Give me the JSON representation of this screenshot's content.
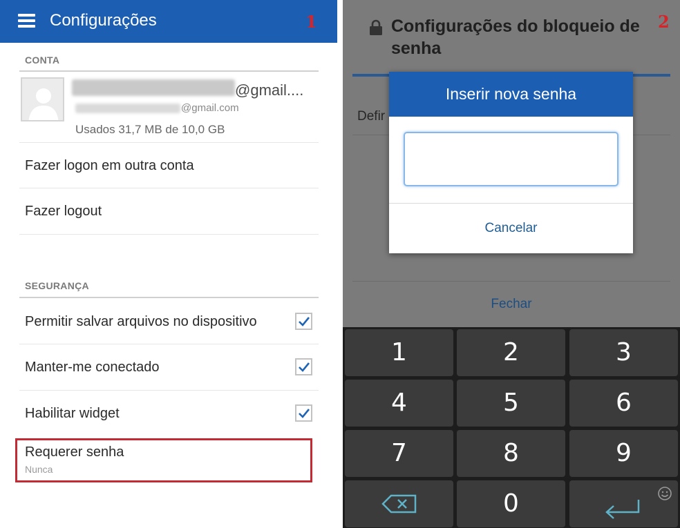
{
  "screen1": {
    "badge": "1",
    "title": "Configurações",
    "account_header": "CONTA",
    "account_email_suffix": "@gmail....",
    "account_email_secondary": "@gmail.com",
    "account_usage": "Usados 31,7 MB de 10,0 GB",
    "login_other": "Fazer logon em outra conta",
    "logout": "Fazer logout",
    "security_header": "SEGURANÇA",
    "security_items": [
      {
        "label": "Permitir salvar arquivos no dispositivo",
        "checked": true
      },
      {
        "label": "Manter-me conectado",
        "checked": true
      },
      {
        "label": "Habilitar widget",
        "checked": true
      }
    ],
    "require_password": {
      "label": "Requerer senha",
      "value": "Nunca"
    },
    "accent_color": "#1c5eb2",
    "highlight_color": "#c42a33"
  },
  "screen2": {
    "badge": "2",
    "title": "Configurações do bloqueio de senha",
    "behind_item": "Defir",
    "dialog_title": "Inserir nova senha",
    "dialog_cancel": "Cancelar",
    "close": "Fechar",
    "keys": [
      "1",
      "2",
      "3",
      "4",
      "5",
      "6",
      "7",
      "8",
      "9",
      "0"
    ],
    "backspace_icon": "backspace-icon",
    "enter_icon": "enter-icon",
    "emoji_icon": "smiley-icon"
  }
}
